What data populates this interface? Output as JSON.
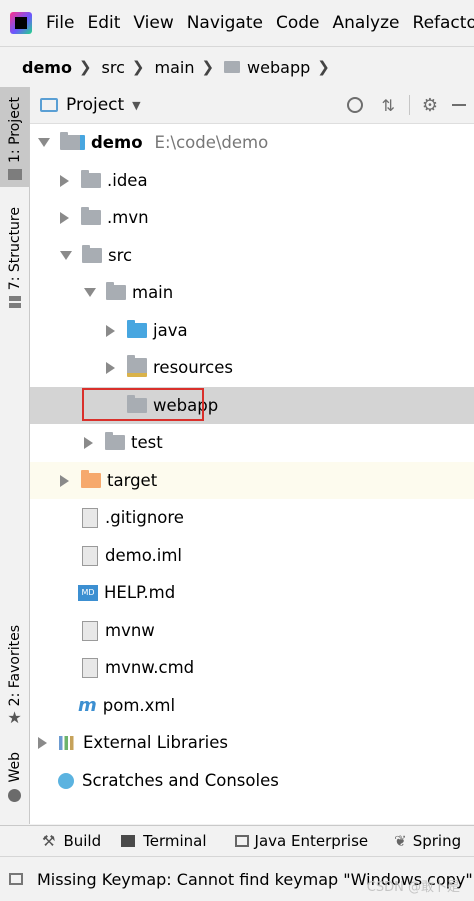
{
  "menu": {
    "items": [
      "File",
      "Edit",
      "View",
      "Navigate",
      "Code",
      "Analyze",
      "Refactor"
    ]
  },
  "breadcrumb": {
    "items": [
      "demo",
      "src",
      "main",
      "webapp"
    ]
  },
  "left_strip": {
    "project_tab": "1: Project",
    "structure_tab": "7: Structure",
    "favorites_tab": "2: Favorites",
    "web_tab": "Web"
  },
  "panel": {
    "title": "Project"
  },
  "tree": {
    "root": {
      "label": "demo",
      "path": "E:\\code\\demo"
    },
    "idea": ".idea",
    "mvn": ".mvn",
    "src": "src",
    "main": "main",
    "java": "java",
    "resources": "resources",
    "webapp": "webapp",
    "test": "test",
    "target": "target",
    "gitignore": ".gitignore",
    "demo_iml": "demo.iml",
    "help_md": "HELP.md",
    "mvnw": "mvnw",
    "mvnw_cmd": "mvnw.cmd",
    "pom_xml": "pom.xml",
    "external_libraries": "External Libraries",
    "scratches": "Scratches and Consoles"
  },
  "toolwindows": {
    "build": "Build",
    "terminal": "Terminal",
    "java_enterprise": "Java Enterprise",
    "spring": "Spring"
  },
  "status": {
    "message": "Missing Keymap: Cannot find keymap \"Windows copy\" /A",
    "watermark": "CSDN @敢卜是"
  },
  "colors": {
    "selection": "#d4d4d4",
    "highlight_box": "#d9302b",
    "folder_blue": "#47a6e0",
    "folder_orange": "#f6a96d"
  }
}
